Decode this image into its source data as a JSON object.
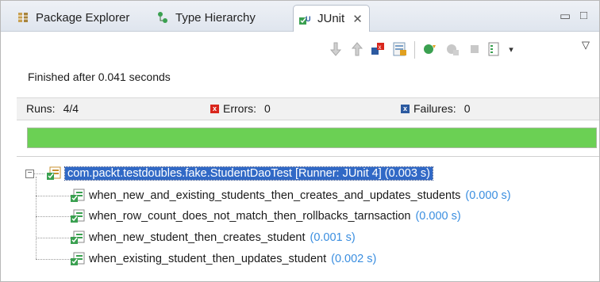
{
  "tabs": [
    {
      "label": "Package Explorer",
      "icon": "package-explorer-icon"
    },
    {
      "label": "Type Hierarchy",
      "icon": "type-hierarchy-icon"
    },
    {
      "label": "JUnit",
      "icon": "junit-icon",
      "active": true,
      "close": "✕"
    }
  ],
  "window_controls": {
    "minimize": "▭",
    "maximize": "□"
  },
  "toolbar_icons": [
    "next-failure-icon",
    "previous-failure-icon",
    "show-failures-only-icon",
    "scroll-lock-icon",
    "rerun-test-icon",
    "rerun-failed-first-icon",
    "stop-icon",
    "test-run-history-icon",
    "view-menu-icon",
    "panel-menu-icon"
  ],
  "status": "Finished after 0.041 seconds",
  "counters": {
    "runs_label": "Runs:",
    "runs_value": "4/4",
    "errors_label": "Errors:",
    "errors_value": "0",
    "failures_label": "Failures:",
    "failures_value": "0"
  },
  "progress": {
    "fraction": 1.0,
    "color": "#6bd054"
  },
  "tree": {
    "root": {
      "label": "com.packt.testdoubles.fake.StudentDaoTest [Runner: JUnit 4] (0.003 s)"
    },
    "children": [
      {
        "name": "when_new_and_existing_students_then_creates_and_updates_students",
        "time": "(0.000 s)"
      },
      {
        "name": "when_row_count_does_not_match_then_rollbacks_tarnsaction",
        "time": "(0.000 s)"
      },
      {
        "name": "when_new_student_then_creates_student",
        "time": "(0.001 s)"
      },
      {
        "name": "when_existing_student_then_updates_student",
        "time": "(0.002 s)"
      }
    ]
  },
  "colors": {
    "accent": "#3169c6",
    "time": "#3a8ee0",
    "error": "#d9261c",
    "failure": "#2c5aa0"
  }
}
